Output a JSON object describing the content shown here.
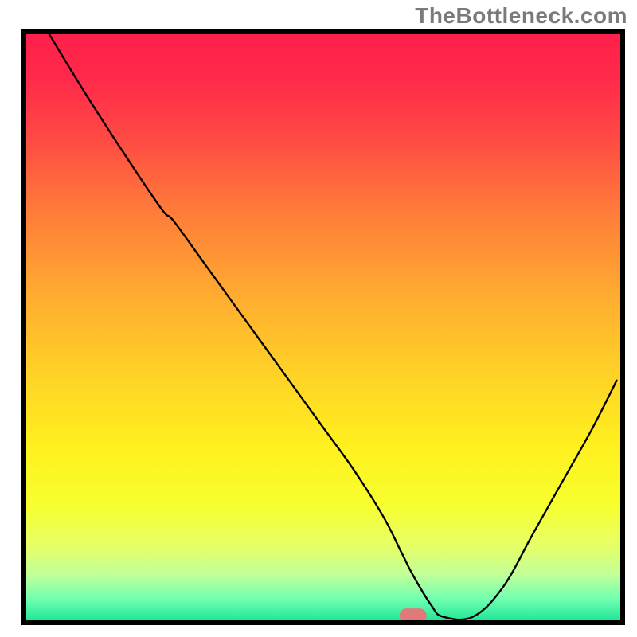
{
  "watermark": "TheBottleneck.com",
  "chart_data": {
    "type": "line",
    "title": "",
    "xlabel": "",
    "ylabel": "",
    "xlim": [
      0,
      100
    ],
    "ylim": [
      0,
      100
    ],
    "legend": null,
    "grid": false,
    "x": [
      4,
      10,
      17,
      23,
      25,
      30,
      35,
      40,
      45,
      50,
      55,
      60,
      63,
      65,
      68,
      70,
      75,
      80,
      85,
      90,
      95,
      99
    ],
    "values": [
      100,
      90,
      79,
      70,
      68,
      61,
      54,
      47,
      40,
      33,
      26,
      18,
      12,
      8,
      3,
      1,
      1,
      6,
      15,
      24,
      33,
      41
    ],
    "marker": {
      "x": 65,
      "y": 1.2,
      "shape": "rounded-rect",
      "color": "#e07a7a"
    },
    "background": {
      "type": "vertical-gradient",
      "stops": [
        {
          "pos": 0.0,
          "color": "#ff1f4b"
        },
        {
          "pos": 0.08,
          "color": "#ff2a4a"
        },
        {
          "pos": 0.18,
          "color": "#ff4a44"
        },
        {
          "pos": 0.3,
          "color": "#ff7a3a"
        },
        {
          "pos": 0.45,
          "color": "#ffad30"
        },
        {
          "pos": 0.58,
          "color": "#ffd226"
        },
        {
          "pos": 0.7,
          "color": "#fff01e"
        },
        {
          "pos": 0.8,
          "color": "#f7ff2e"
        },
        {
          "pos": 0.87,
          "color": "#e6ff66"
        },
        {
          "pos": 0.92,
          "color": "#c0ff9a"
        },
        {
          "pos": 0.96,
          "color": "#70ffb0"
        },
        {
          "pos": 1.0,
          "color": "#18e496"
        }
      ]
    },
    "frame_color": "#000000",
    "line_color": "#000000",
    "line_width": 2.4
  }
}
